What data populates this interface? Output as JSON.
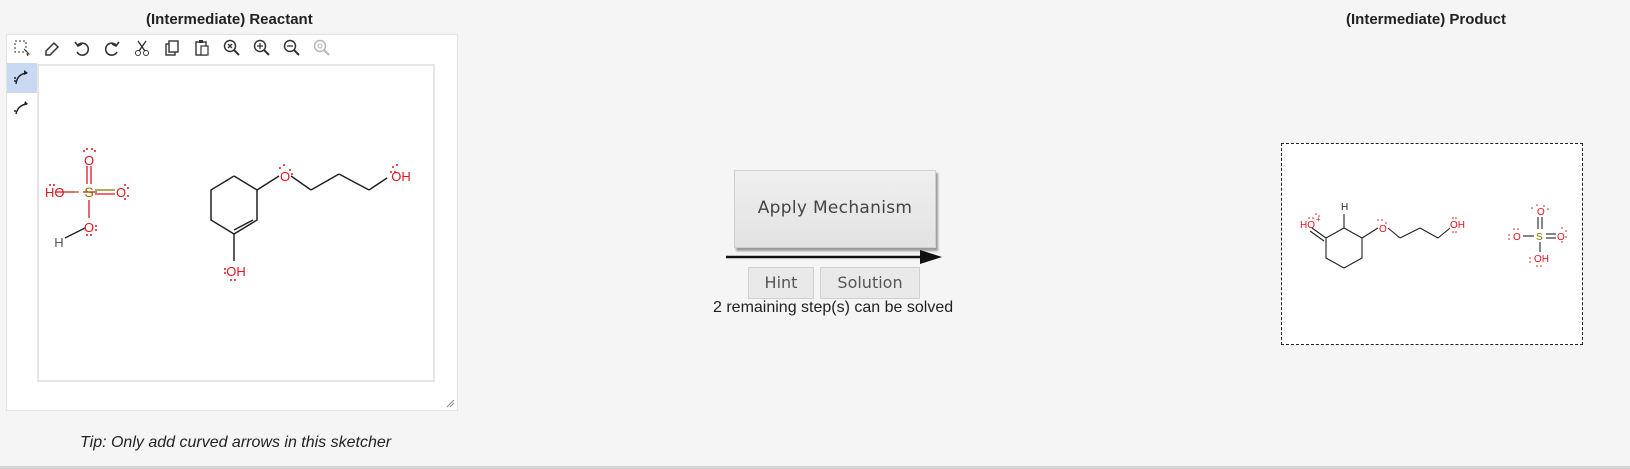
{
  "reactant": {
    "title": "(Intermediate) Reactant",
    "tip": "Tip: Only add curved arrows in this sketcher",
    "toolbar": [
      "lasso-select",
      "erase",
      "undo",
      "redo",
      "cut",
      "copy",
      "paste",
      "zoom-reset",
      "zoom-in",
      "zoom-out",
      "zoom-fit"
    ],
    "side_tools": [
      "curved-arrow-pair",
      "curved-arrow-single"
    ],
    "molecules": {
      "sulfuric_acid": {
        "atoms": [
          "HO",
          "S",
          "O",
          "O",
          "H"
        ]
      },
      "cyclohexenol_ether": {
        "atoms": [
          "O",
          "OH",
          "OH"
        ]
      }
    }
  },
  "middle": {
    "apply_label": "Apply Mechanism",
    "hint_label": "Hint",
    "solution_label": "Solution",
    "status": "2 remaining step(s) can be solved"
  },
  "product": {
    "title": "(Intermediate) Product",
    "labels": {
      "ho_plus": "HO",
      "h": "H",
      "o_ether": "O",
      "oh": "OH",
      "sulfate_o_top": "O",
      "sulfate_o_left": "O",
      "sulfate_s": "S",
      "sulfate_o_right": "O",
      "sulfate_oh": "OH"
    }
  },
  "colors": {
    "atom_red": "#e0141e",
    "sulfur": "#7a7a00",
    "bond": "#222222"
  }
}
